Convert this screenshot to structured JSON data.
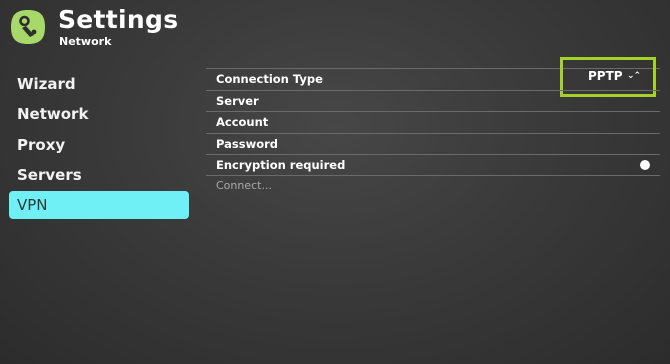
{
  "header": {
    "title": "Settings",
    "subtitle": "Network",
    "logo_icon": "app-logo-icon"
  },
  "sidebar": {
    "items": [
      {
        "label": "Wizard",
        "active": false
      },
      {
        "label": "Network",
        "active": false
      },
      {
        "label": "Proxy",
        "active": false
      },
      {
        "label": "Servers",
        "active": false
      },
      {
        "label": "VPN",
        "active": true
      }
    ]
  },
  "panel": {
    "connection_type": {
      "label": "Connection Type",
      "value": "PPTP"
    },
    "server": {
      "label": "Server"
    },
    "account": {
      "label": "Account"
    },
    "password": {
      "label": "Password"
    },
    "encryption": {
      "label": "Encryption required",
      "enabled": false
    },
    "connect": {
      "label": "Connect..."
    }
  },
  "colors": {
    "active_item": "#6ff0f4",
    "focus_border": "#a5d128",
    "logo": "#a8d86a"
  }
}
